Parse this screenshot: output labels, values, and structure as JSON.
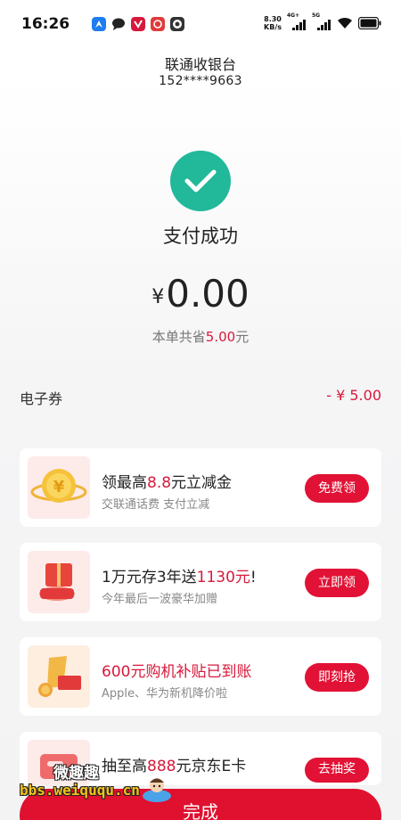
{
  "status_bar": {
    "time": "16:26",
    "net_speed_value": "8.30",
    "net_speed_unit": "KB/s",
    "sim1_label": "4G+",
    "sim2_label": "5G",
    "app_icons": [
      "map-app-icon",
      "chat-bubble-icon",
      "red-app-icon",
      "red-app-icon-2",
      "circle-app-icon"
    ]
  },
  "header": {
    "merchant_name": "联通收银台",
    "account": "152****9663"
  },
  "result": {
    "title": "支付成功",
    "currency_symbol": "¥",
    "amount": "0.00",
    "saved_prefix": "本单共省",
    "saved_amount": "5.00",
    "saved_suffix": "元"
  },
  "coupon": {
    "label": "电子券",
    "value": "- ¥ 5.00"
  },
  "promos": [
    {
      "title_pre": "领最高",
      "title_hl": "8.8",
      "title_post": "元立减金",
      "subtitle": "交联通话费 支付立减",
      "button": "免费领",
      "icon": "gold-coin-icon"
    },
    {
      "title_pre": "1万元存3年送",
      "title_hl": "1130元",
      "title_post": "!",
      "subtitle": "今年最后一波豪华加赠",
      "button": "立即领",
      "icon": "gift-box-icon"
    },
    {
      "title": "600元购机补贴已到账",
      "subtitle": "Apple、华为新机降价啦",
      "button": "即刻抢",
      "icon": "red-envelope-icon"
    },
    {
      "title_pre": "抽至高",
      "title_hl": "888",
      "title_post": "元京东E卡",
      "button": "去抽奖",
      "icon": "gift-card-icon"
    }
  ],
  "done_button": "完成",
  "watermark": {
    "title": "微趣趣",
    "url": "bbs.weiququ.cn"
  },
  "colors": {
    "brand_red": "#e0102f",
    "success_green": "#22b89a",
    "highlight_red": "#d8193c"
  }
}
